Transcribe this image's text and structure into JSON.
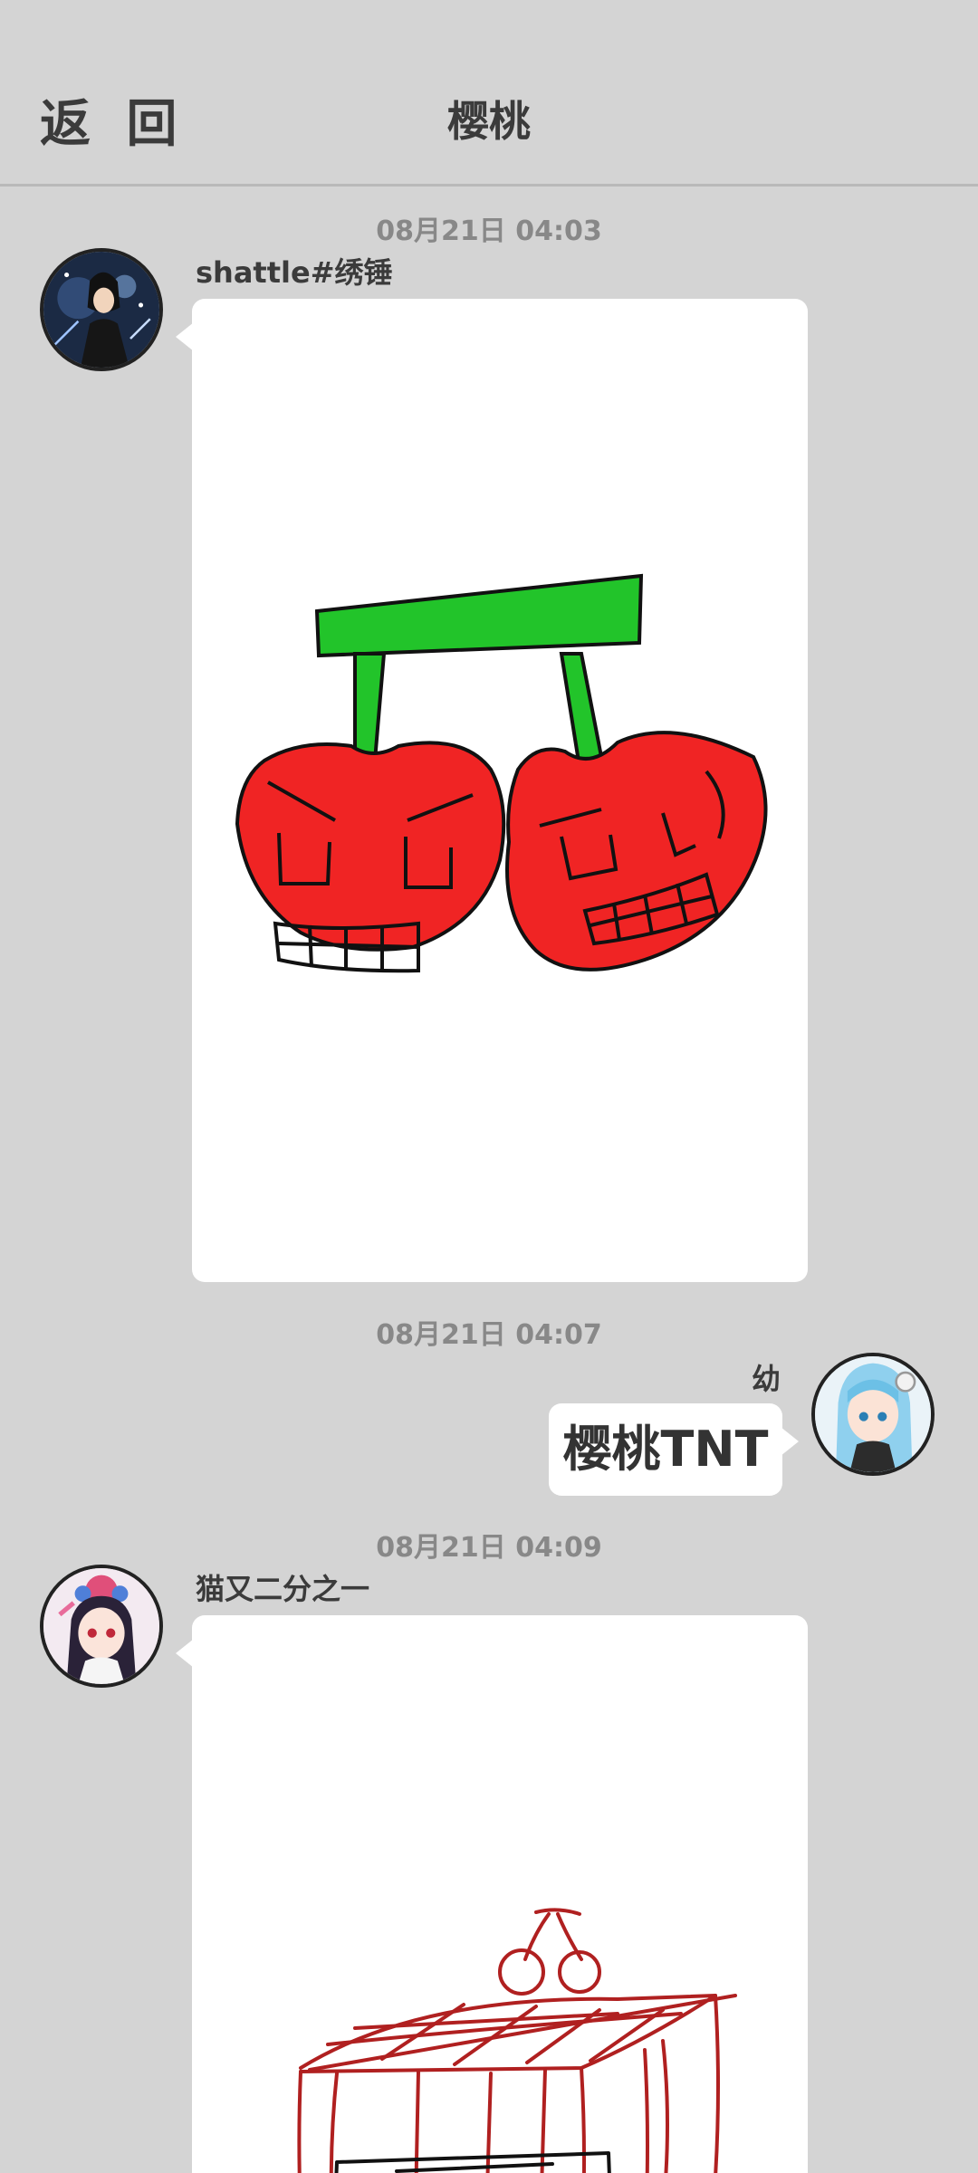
{
  "header": {
    "back_label": "返 回",
    "title": "樱桃"
  },
  "messages": [
    {
      "time": "08月21日  04:03",
      "sender": "shattle#绣锤",
      "side": "left",
      "type": "drawing",
      "drawing": "cherries"
    },
    {
      "time": "08月21日  04:07",
      "sender": "幼",
      "side": "right",
      "type": "text",
      "text": "樱桃TNT"
    },
    {
      "time": "08月21日  04:09",
      "sender": "猫又二分之一",
      "side": "left",
      "type": "drawing",
      "drawing": "cherry-tnt-box"
    }
  ],
  "colors": {
    "background": "#d4d4d4",
    "bubble": "#ffffff",
    "cherry_red": "#f02424",
    "stem_green": "#22c42a",
    "sketch_red": "#b02020"
  }
}
